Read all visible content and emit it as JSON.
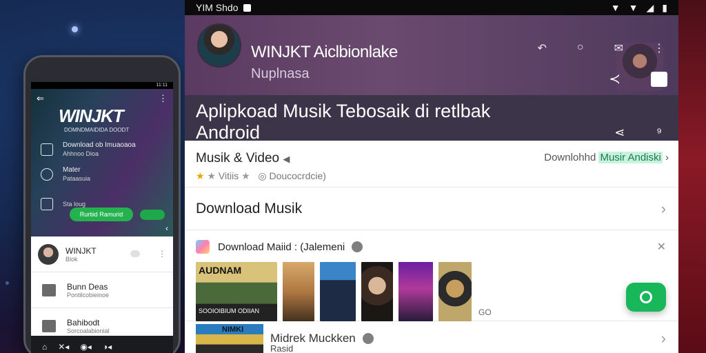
{
  "status_bar": {
    "left_text": "YIM Shdo",
    "icons": [
      "wifi-icon",
      "wifi-icon",
      "signal-icon",
      "battery-icon"
    ]
  },
  "phone": {
    "status": "11:11",
    "logo": "WINJKT",
    "subtitle": "DOMNDMAIDIDA DOODT",
    "rows": [
      {
        "label": "Download ob Imuaoaoa",
        "sub": "Ahhnoo Dioa"
      },
      {
        "label": "Mater",
        "sub": "Pataasuia"
      },
      {
        "label": "",
        "sub": "Sta loug"
      }
    ],
    "pill": "Rurtiid Ramurid",
    "list": [
      {
        "title": "WINJKT",
        "sub": "Blok"
      },
      {
        "title": "Bunn Deas",
        "sub": "Pontilcobieinoe"
      },
      {
        "title": "Bahibodt",
        "sub": "Sorcoalabionial"
      }
    ],
    "nav": [
      "⌂",
      "✕◂",
      "◉◂",
      "◑◂"
    ]
  },
  "header": {
    "name": "WINJKT Aiclbionlake",
    "handle": "Nuplnasa",
    "title_line1": "Aplipkoad Musik Tebosaik di retlbak",
    "title_line2": "Android"
  },
  "category": {
    "title": "Musik & Video",
    "rating_text": "Vitiis",
    "developer": "Doucocrdcie)",
    "link_prefix": "Downlohhd ",
    "link_highlight": "Musir Andiski"
  },
  "download_row": {
    "label": "Download Musik"
  },
  "album_row": {
    "title": "Download Maiid :",
    "meta": "(Jalemeni",
    "cover_caption": "AUDNAM",
    "cover_sub": "SOOIOIBIUM ODIIAN",
    "more": "GO"
  },
  "bottom_row": {
    "title": "Midrek Muckken",
    "cover_caption": "NIMKI",
    "sub": "Rasid"
  },
  "colors": {
    "header_bg": "#5a3a60",
    "accent_green": "#18b85a",
    "highlight": "#c7f2dd"
  }
}
